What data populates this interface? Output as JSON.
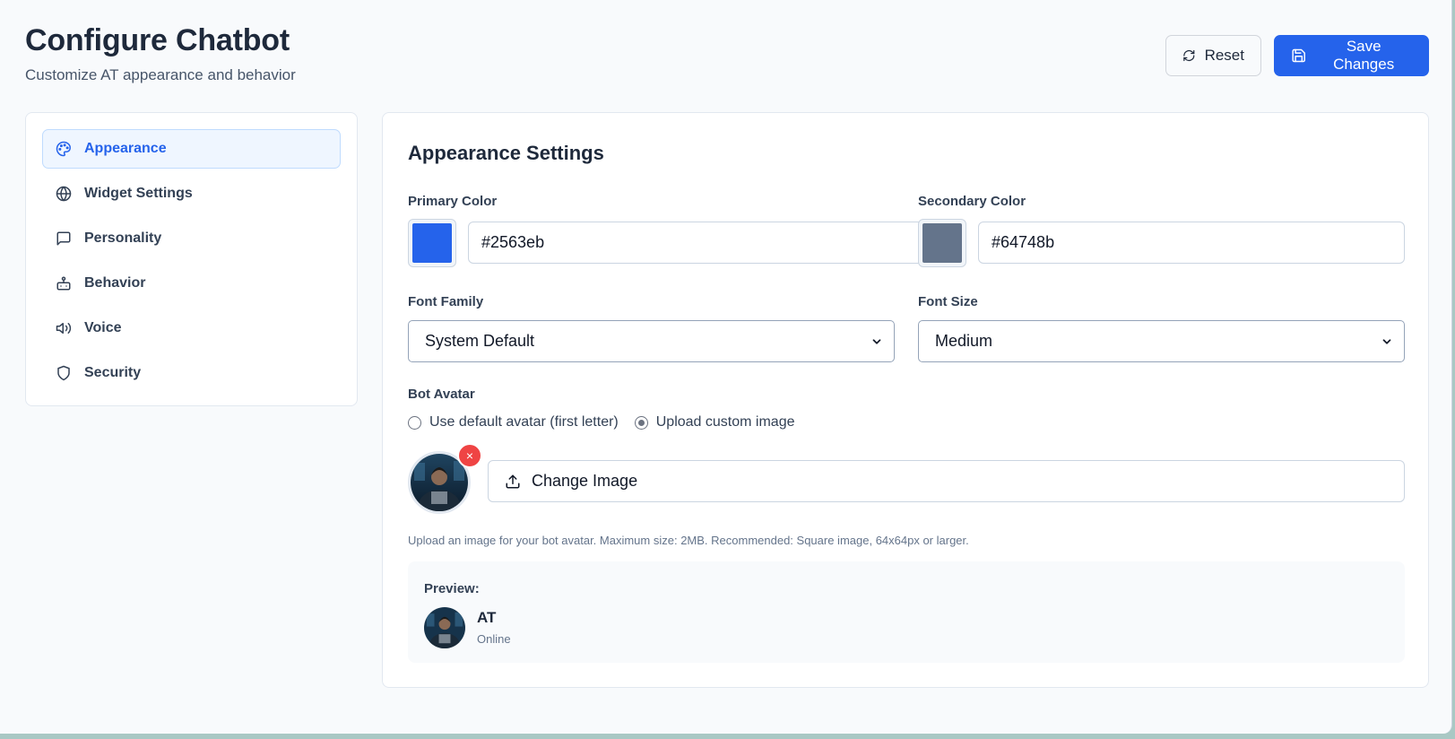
{
  "header": {
    "title": "Configure Chatbot",
    "subtitle": "Customize AT appearance and behavior",
    "reset_label": "Reset",
    "save_label": "Save Changes"
  },
  "sidebar": {
    "items": [
      {
        "label": "Appearance",
        "icon": "palette-icon",
        "active": true
      },
      {
        "label": "Widget Settings",
        "icon": "globe-icon"
      },
      {
        "label": "Personality",
        "icon": "message-square-icon"
      },
      {
        "label": "Behavior",
        "icon": "bot-icon"
      },
      {
        "label": "Voice",
        "icon": "speaker-icon"
      },
      {
        "label": "Security",
        "icon": "shield-icon"
      }
    ]
  },
  "appearance": {
    "heading": "Appearance Settings",
    "primary_color": {
      "label": "Primary Color",
      "value": "#2563eb"
    },
    "secondary_color": {
      "label": "Secondary Color",
      "value": "#64748b"
    },
    "font_family": {
      "label": "Font Family",
      "selected": "System Default"
    },
    "font_size": {
      "label": "Font Size",
      "selected": "Medium"
    },
    "avatar": {
      "label": "Bot Avatar",
      "option_default": "Use default avatar (first letter)",
      "option_custom": "Upload custom image",
      "selected": "custom",
      "remove_label": "×",
      "change_label": "Change Image",
      "help_text": "Upload an image for your bot avatar. Maximum size: 2MB. Recommended: Square image, 64x64px or larger."
    },
    "preview": {
      "label": "Preview:",
      "bot_name": "AT",
      "status": "Online"
    }
  }
}
